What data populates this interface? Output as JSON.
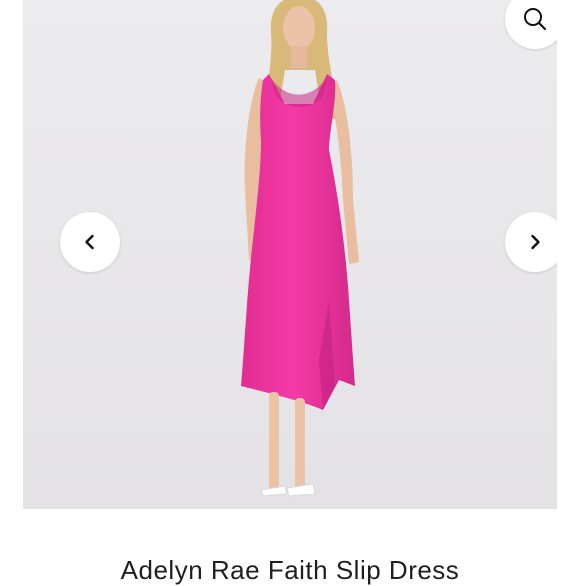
{
  "product": {
    "title": "Adelyn Rae Faith Slip Dress",
    "image_alt": "Model wearing a hot pink satin cowl neck slip midi dress with side slit and white strappy heels"
  },
  "gallery": {
    "prev_icon": "chevron-left-icon",
    "next_icon": "chevron-right-icon",
    "zoom_icon": "search-icon"
  },
  "colors": {
    "background": "#eae8ea",
    "dress": "#f0329f",
    "button": "#ffffff"
  }
}
